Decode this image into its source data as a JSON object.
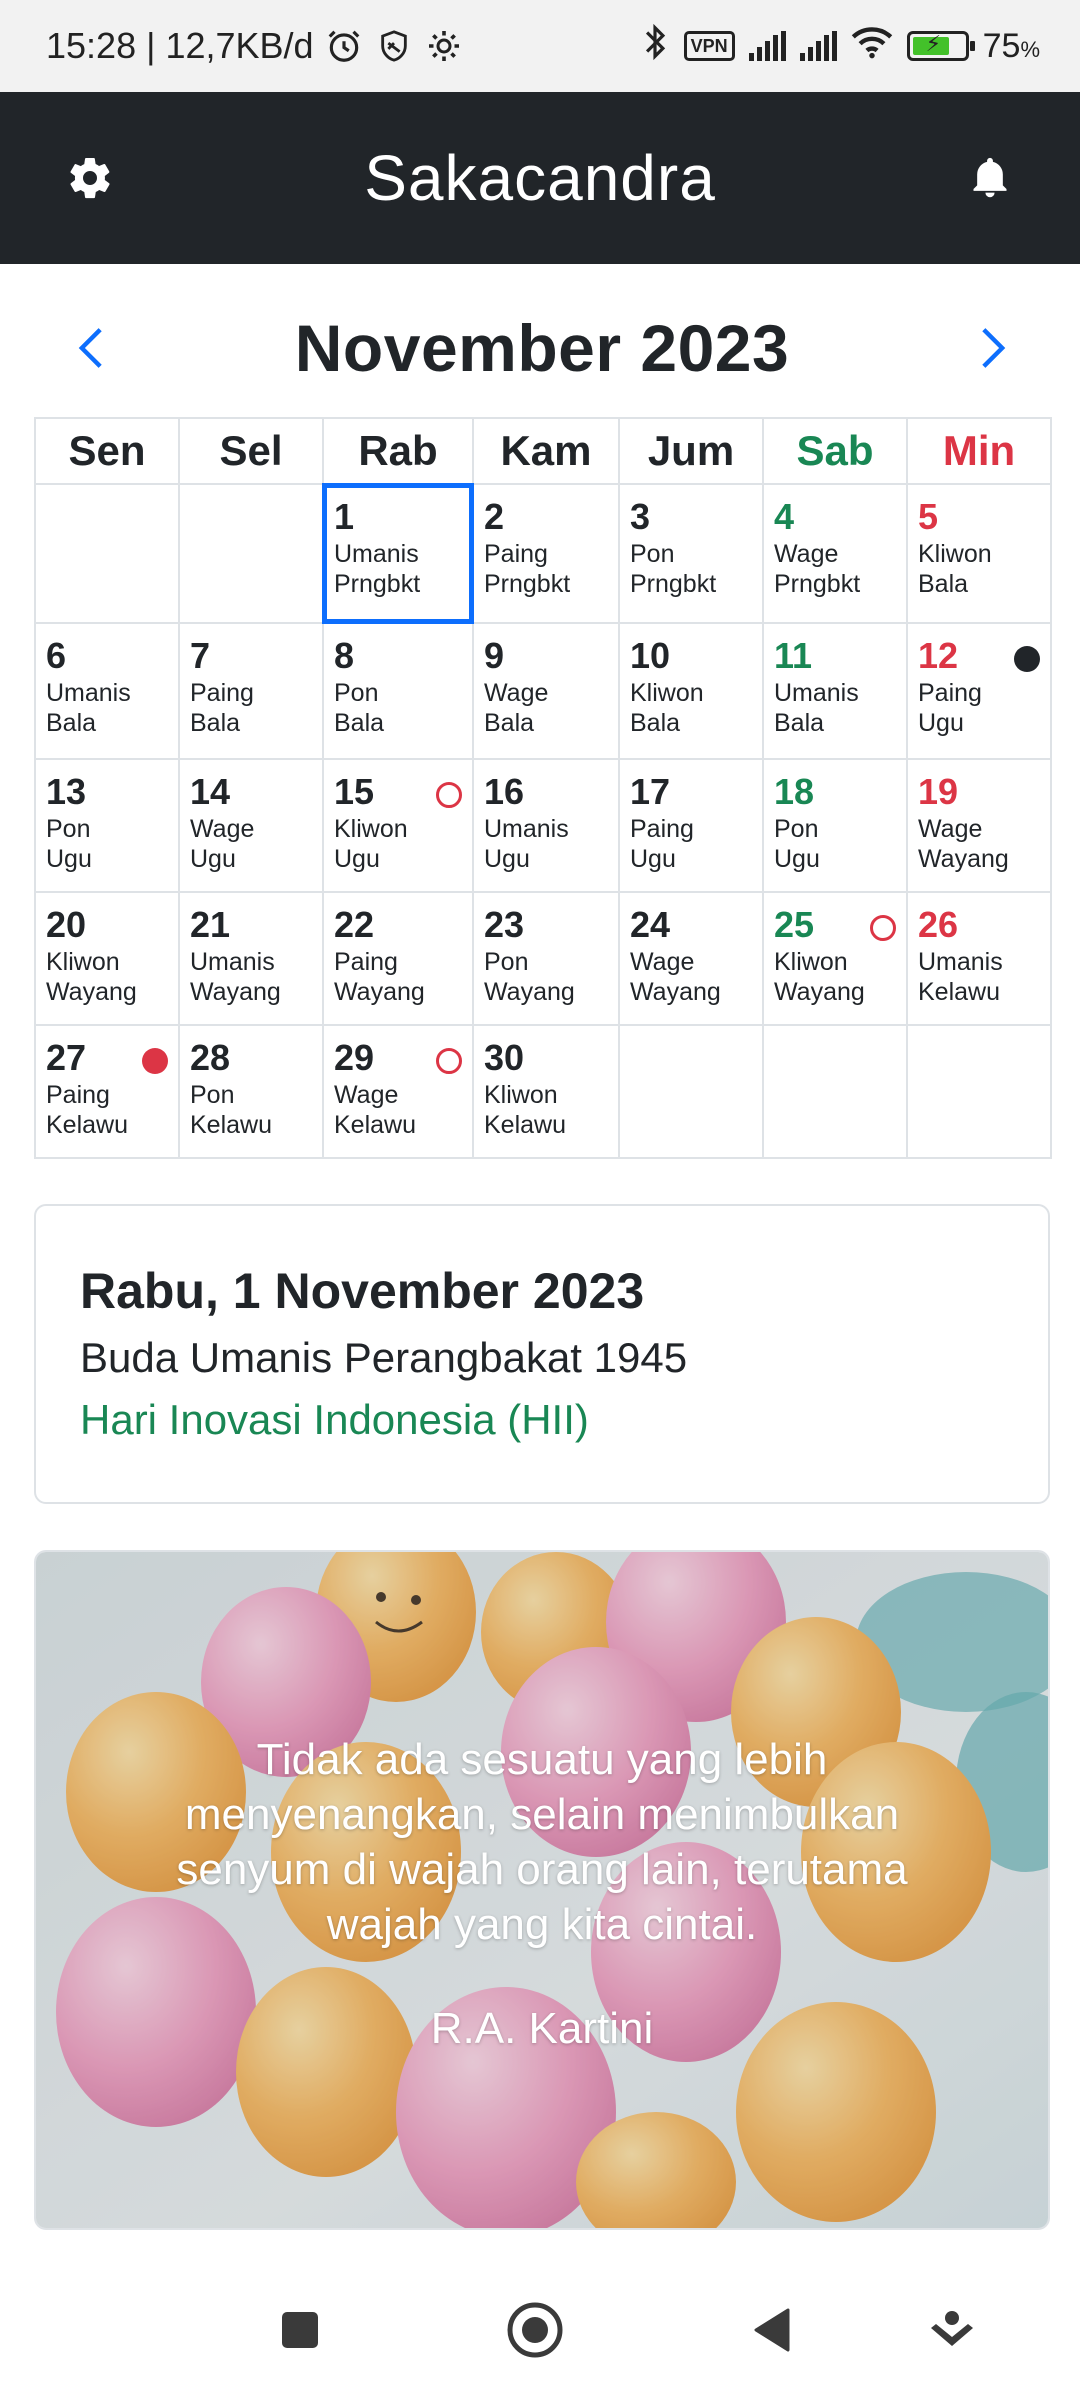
{
  "status_bar": {
    "time_speed": "15:28 | 12,7KB/d",
    "vpn": "VPN",
    "battery": "75",
    "battery_unit": "%",
    "icons": [
      "alarm-icon",
      "shield-icon",
      "gear-icon",
      "bluetooth-icon",
      "signal-icon",
      "wifi-icon",
      "battery-charging-icon"
    ]
  },
  "header": {
    "title": "Sakacandra",
    "left_icon": "gear-icon",
    "right_icon": "bell-icon"
  },
  "calendar": {
    "month_title": "November 2023",
    "prev_icon": "chevron-left-icon",
    "next_icon": "chevron-right-icon",
    "weekdays": [
      "Sen",
      "Sel",
      "Rab",
      "Kam",
      "Jum",
      "Sab",
      "Min"
    ],
    "weeks": [
      [
        null,
        null,
        {
          "day": "1",
          "pasaran": "Umanis",
          "wuku": "Prngbkt",
          "selected": true
        },
        {
          "day": "2",
          "pasaran": "Paing",
          "wuku": "Prngbkt"
        },
        {
          "day": "3",
          "pasaran": "Pon",
          "wuku": "Prngbkt"
        },
        {
          "day": "4",
          "pasaran": "Wage",
          "wuku": "Prngbkt"
        },
        {
          "day": "5",
          "pasaran": "Kliwon",
          "wuku": "Bala"
        }
      ],
      [
        {
          "day": "6",
          "pasaran": "Umanis",
          "wuku": "Bala"
        },
        {
          "day": "7",
          "pasaran": "Paing",
          "wuku": "Bala"
        },
        {
          "day": "8",
          "pasaran": "Pon",
          "wuku": "Bala"
        },
        {
          "day": "9",
          "pasaran": "Wage",
          "wuku": "Bala"
        },
        {
          "day": "10",
          "pasaran": "Kliwon",
          "wuku": "Bala"
        },
        {
          "day": "11",
          "pasaran": "Umanis",
          "wuku": "Bala"
        },
        {
          "day": "12",
          "pasaran": "Paing",
          "wuku": "Ugu",
          "marker": "full-black"
        }
      ],
      [
        {
          "day": "13",
          "pasaran": "Pon",
          "wuku": "Ugu"
        },
        {
          "day": "14",
          "pasaran": "Wage",
          "wuku": "Ugu"
        },
        {
          "day": "15",
          "pasaran": "Kliwon",
          "wuku": "Ugu",
          "marker": "ring-red"
        },
        {
          "day": "16",
          "pasaran": "Umanis",
          "wuku": "Ugu"
        },
        {
          "day": "17",
          "pasaran": "Paing",
          "wuku": "Ugu"
        },
        {
          "day": "18",
          "pasaran": "Pon",
          "wuku": "Ugu"
        },
        {
          "day": "19",
          "pasaran": "Wage",
          "wuku": "Wayang"
        }
      ],
      [
        {
          "day": "20",
          "pasaran": "Kliwon",
          "wuku": "Wayang"
        },
        {
          "day": "21",
          "pasaran": "Umanis",
          "wuku": "Wayang"
        },
        {
          "day": "22",
          "pasaran": "Paing",
          "wuku": "Wayang"
        },
        {
          "day": "23",
          "pasaran": "Pon",
          "wuku": "Wayang"
        },
        {
          "day": "24",
          "pasaran": "Wage",
          "wuku": "Wayang"
        },
        {
          "day": "25",
          "pasaran": "Kliwon",
          "wuku": "Wayang",
          "marker": "ring-red"
        },
        {
          "day": "26",
          "pasaran": "Umanis",
          "wuku": "Kelawu"
        }
      ],
      [
        {
          "day": "27",
          "pasaran": "Paing",
          "wuku": "Kelawu",
          "marker": "solid-red"
        },
        {
          "day": "28",
          "pasaran": "Pon",
          "wuku": "Kelawu"
        },
        {
          "day": "29",
          "pasaran": "Wage",
          "wuku": "Kelawu",
          "marker": "ring-red"
        },
        {
          "day": "30",
          "pasaran": "Kliwon",
          "wuku": "Kelawu"
        },
        null,
        null,
        null
      ]
    ]
  },
  "selected_day": {
    "date": "Rabu, 1 November 2023",
    "javanese": "Buda Umanis Perangbakat 1945",
    "holiday": "Hari Inovasi Indonesia (HII)"
  },
  "quote": {
    "text": "Tidak ada sesuatu yang lebih menyenangkan, selain menimbulkan senyum di wajah orang lain, terutama wajah yang kita cintai.",
    "author": "R.A. Kartini"
  },
  "colors": {
    "header_bg": "#212529",
    "saturday": "#198754",
    "sunday": "#dc3545",
    "selected_outline": "#0d6efd",
    "nav_arrow": "#0d6efd",
    "holiday_text": "#198754"
  },
  "nav_bar": {
    "icons": [
      "recents-square-icon",
      "home-circle-icon",
      "back-triangle-icon",
      "assistant-icon"
    ]
  }
}
